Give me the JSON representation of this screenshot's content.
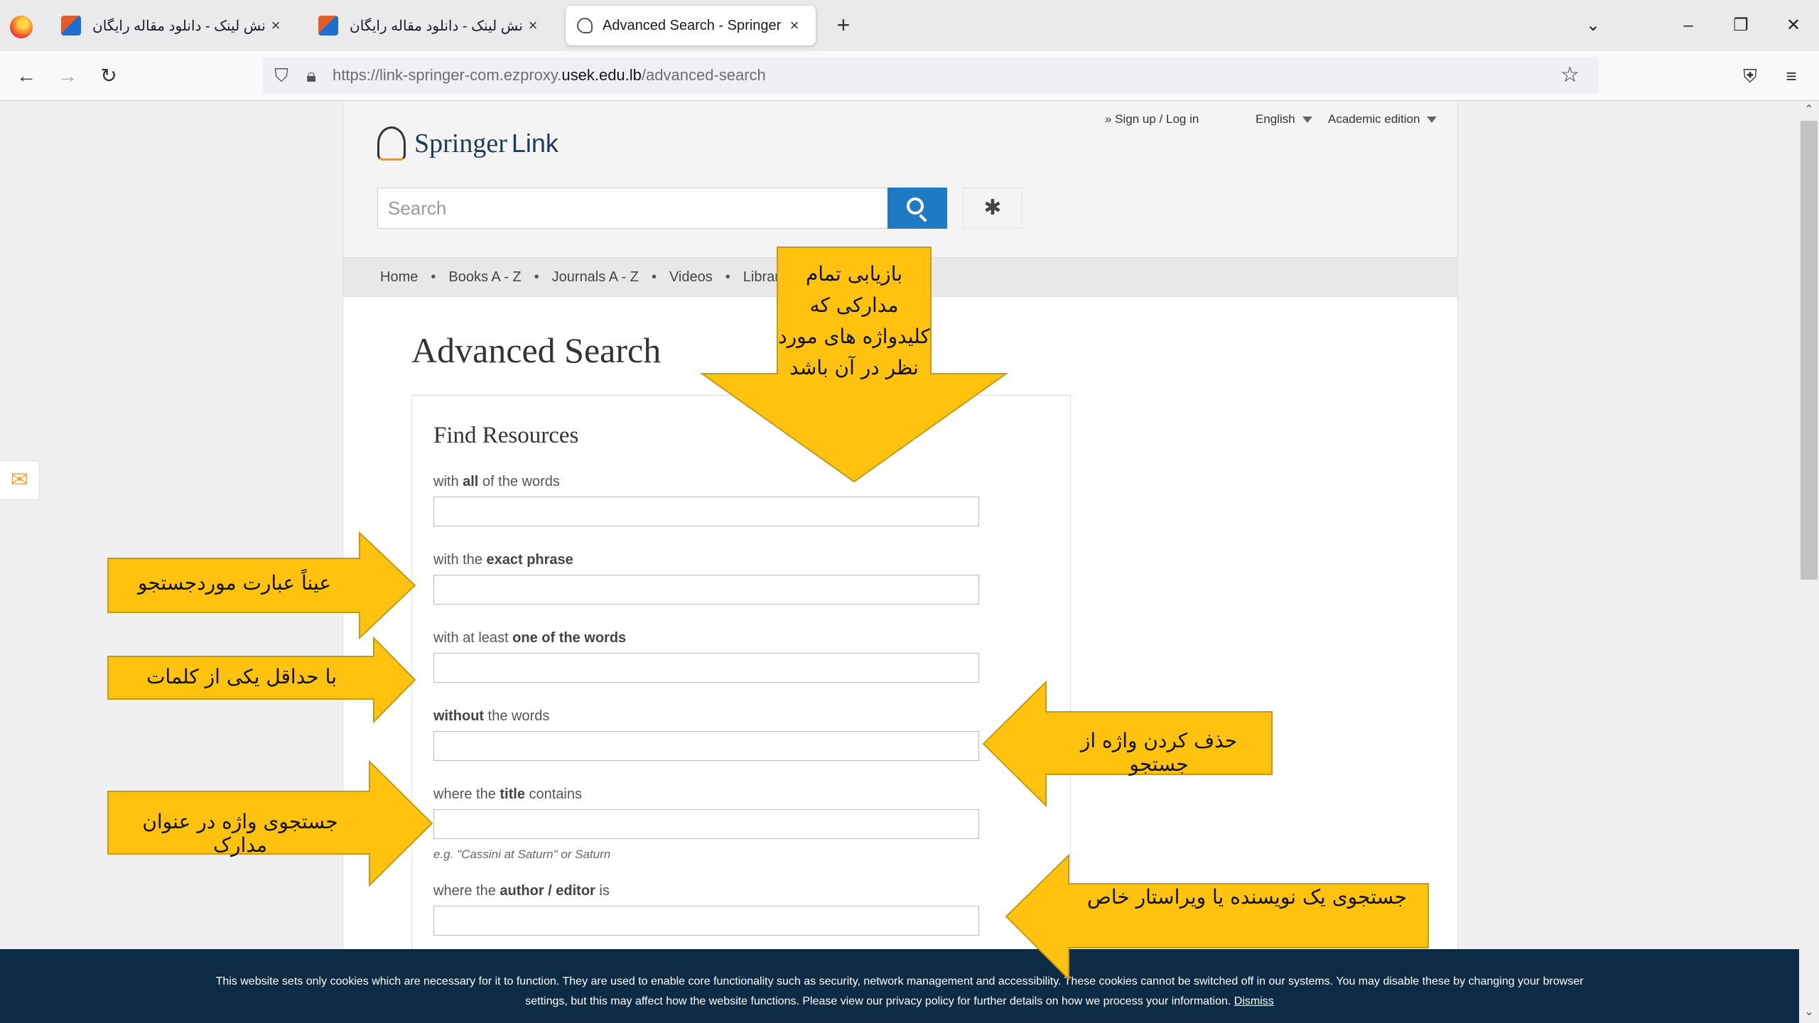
{
  "browser": {
    "tabs": [
      {
        "title": "دانش لینک - دانلود مقاله رایگان،",
        "active": false
      },
      {
        "title": "دانش لینک - دانلود مقاله رایگان،",
        "active": false
      },
      {
        "title": "Advanced Search - Springer",
        "active": true
      }
    ],
    "new_tab": "+",
    "url_prefix": "https://link-springer-com.ezproxy.",
    "url_domain": "usek.edu.lb",
    "url_path": "/advanced-search"
  },
  "header": {
    "logo_springer": "Springer",
    "logo_link": "Link",
    "signup": "» Sign up / Log in",
    "language": "English",
    "edition": "Academic edition",
    "search_placeholder": "Search"
  },
  "nav": {
    "items": [
      "Home",
      "Books A - Z",
      "Journals A - Z",
      "Videos",
      "Librarians"
    ]
  },
  "page": {
    "title": "Advanced Search",
    "heading": "Find Resources",
    "fields": {
      "all_pre": "with ",
      "all_b": "all",
      "all_post": " of the words",
      "exact_pre": "with the ",
      "exact_b": "exact phrase",
      "one_pre": "with at least ",
      "one_b": "one of the words",
      "without_b": "without",
      "without_post": " the words",
      "title_pre": "where the ",
      "title_b": "title",
      "title_post": " contains",
      "title_hint": "e.g. \"Cassini at Saturn\" or Saturn",
      "author_pre": "where the ",
      "author_b": "author / editor",
      "author_post": " is"
    }
  },
  "cookie": {
    "line1": "This website sets only cookies which are necessary for it to function. They are used to enable core functionality such as security, network management and accessibility. These cookies cannot be switched off in our systems. You may disable these by changing your browser",
    "line2": "settings, but this may affect how the website functions. Please view our privacy policy for further details on how we process your information.",
    "dismiss": "Dismiss"
  },
  "annotations": {
    "all_words": "بازیابی تمام مدارکی که کلیدواژه های مورد نظر در آن باشد",
    "exact_phrase": "عیناً عبارت موردجستجو",
    "one_word": "با حداقل یکی از کلمات",
    "without": "حذف کردن واژه از جستجو",
    "title": "جستجوی واژه در عنوان مدارک",
    "author": "جستجوی یک نویسنده یا ویراستار خاص"
  },
  "colors": {
    "callout_fill": "#ffc20e",
    "callout_stroke": "#c59a16",
    "search_button": "#1f7ac4",
    "cookie_bar": "#0e2b45"
  }
}
